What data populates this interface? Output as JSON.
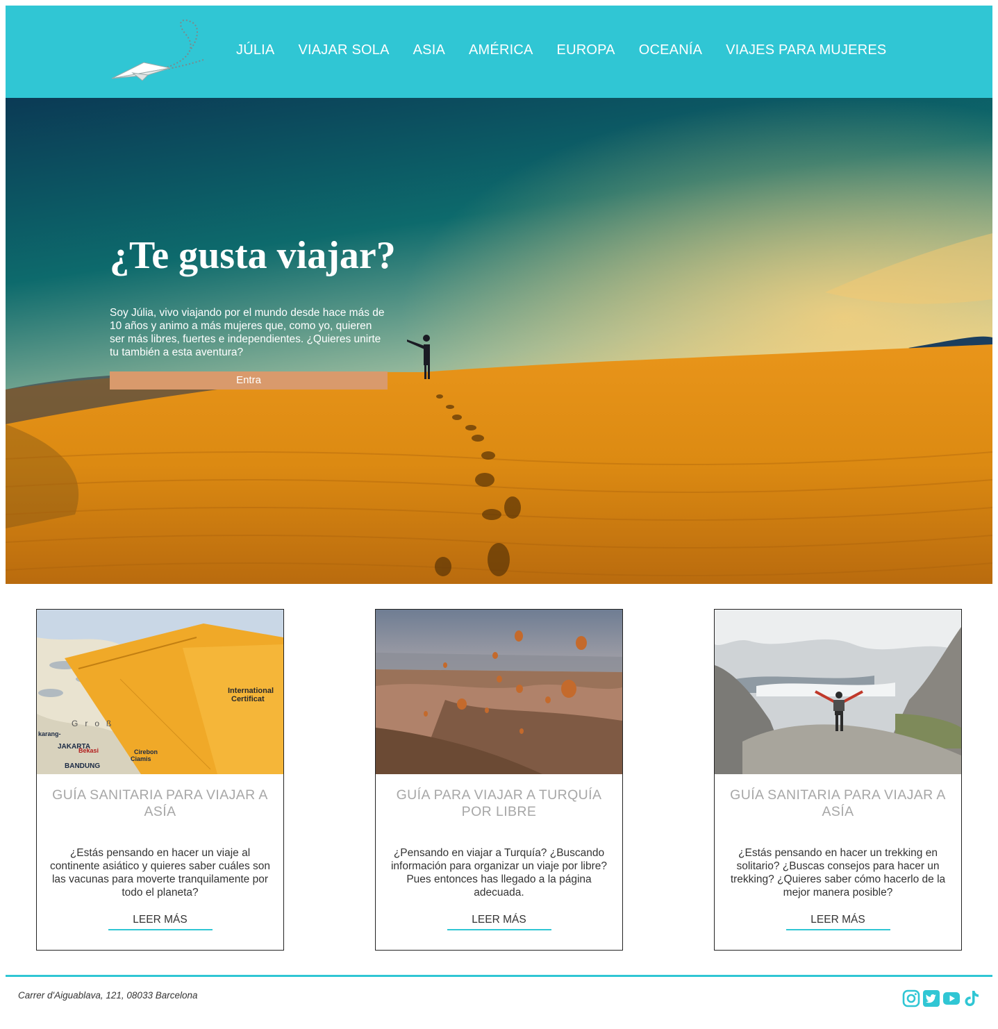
{
  "nav": {
    "items": [
      "JÚLIA",
      "VIAJAR SOLA",
      "ASIA",
      "AMÉRICA",
      "EUROPA",
      "OCEANÍA",
      "VIAJES PARA MUJERES"
    ]
  },
  "hero": {
    "title": "¿Te gusta viajar?",
    "text": "Soy Júlia, vivo viajando por el mundo desde hace más de 10 años y animo a más mujeres que, como yo, quieren ser más libres, fuertes e independientes. ¿Quieres unirte tu también a esta aventura?",
    "button": "Entra"
  },
  "cards": [
    {
      "title": "GUÍA SANITARIA PARA VIAJAR A ASÍA",
      "desc": "¿Estás pensando en hacer un viaje al continente asiático y quieres saber cuáles son las vacunas para moverte tranquilamente por todo el planeta?",
      "more": "LEER MÁS",
      "image_text": [
        "International",
        "Certificat",
        "JAKARTA",
        "Bekasi",
        "BANDUNG",
        "karang-",
        "Ciamis",
        "Cirebon",
        "Groß"
      ]
    },
    {
      "title": "GUÍA PARA VIAJAR A TURQUÍA POR LIBRE",
      "desc": "¿Pensando en viajar a Turquía? ¿Buscando información para organizar un viaje por libre? Pues entonces has llegado a la página adecuada.",
      "more": "LEER MÁS"
    },
    {
      "title": "GUÍA SANITARIA PARA VIAJAR A ASÍA",
      "desc": "¿Estás pensando en hacer un trekking en solitario? ¿Buscas consejos para hacer un trekking? ¿Quieres saber cómo hacerlo de la mejor manera posible?",
      "more": "LEER MÁS"
    }
  ],
  "footer": {
    "address": "Carrer d'Aiguablava, 121, 08033 Barcelona",
    "socials": [
      "instagram-icon",
      "twitter-icon",
      "youtube-icon",
      "tiktok-icon"
    ]
  },
  "colors": {
    "brand": "#30c6d4",
    "button": "#d99a6c",
    "card_title": "#a7a7a7"
  }
}
